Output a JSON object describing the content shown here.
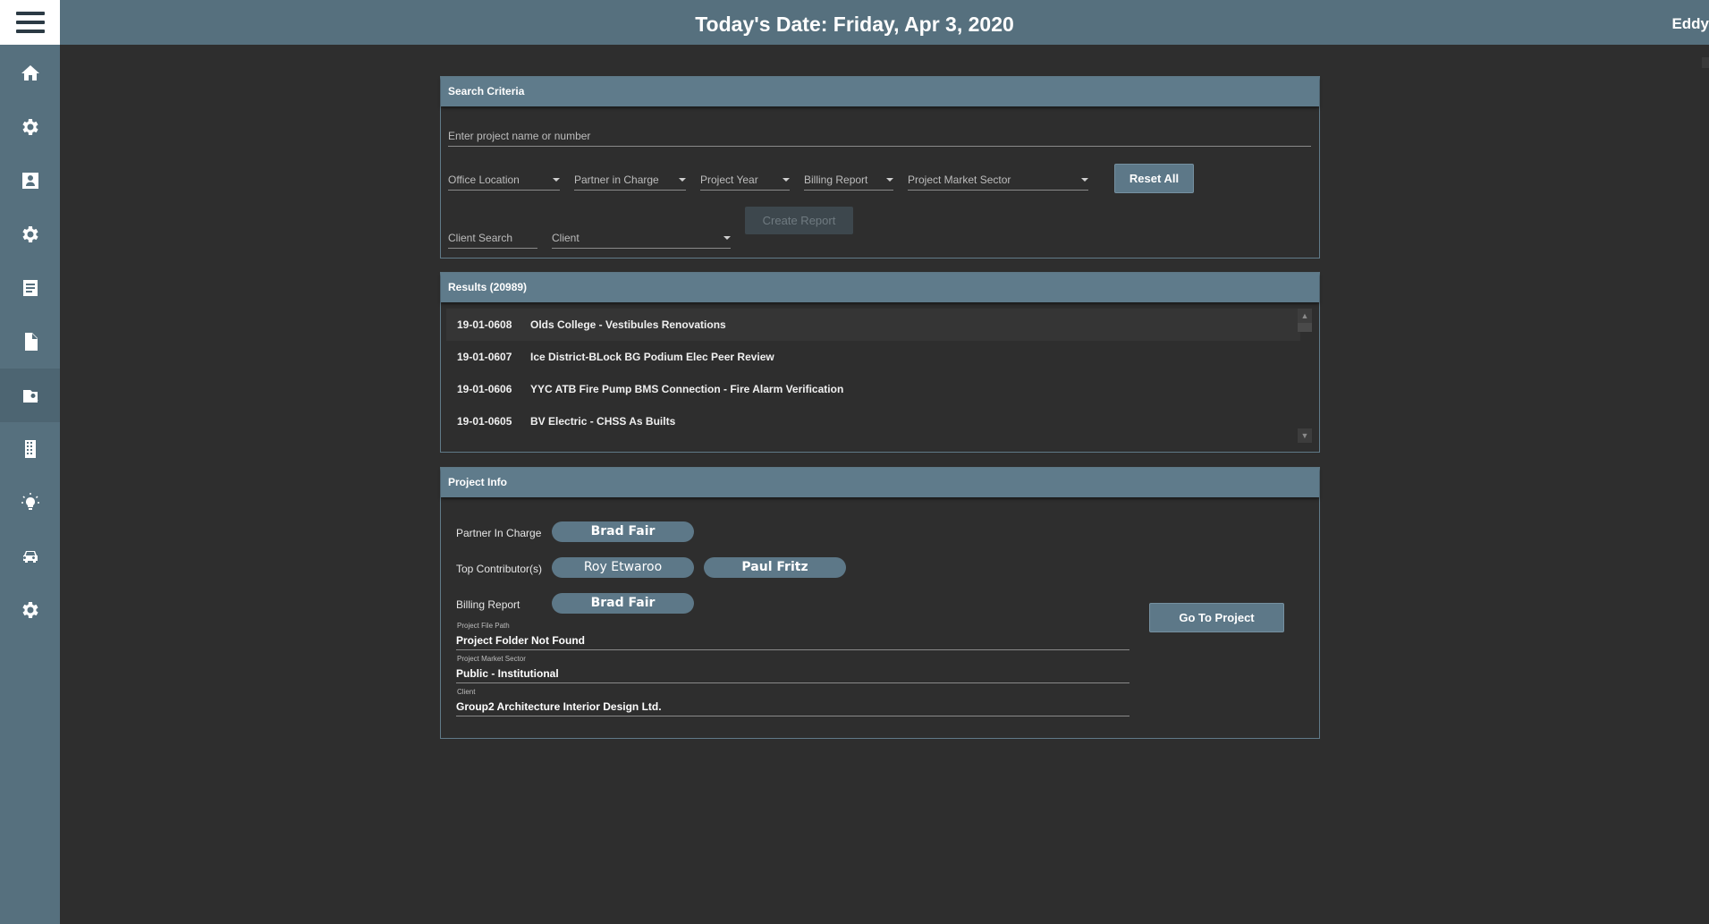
{
  "header": {
    "date_title": "Today's Date: Friday, Apr 3, 2020",
    "user": "Eddy"
  },
  "sidebar": {
    "items": [
      {
        "icon": "home-icon"
      },
      {
        "icon": "gear-icon"
      },
      {
        "icon": "contact-card-icon"
      },
      {
        "icon": "gear-icon"
      },
      {
        "icon": "document-list-icon"
      },
      {
        "icon": "file-icon"
      },
      {
        "icon": "folder-search-icon"
      },
      {
        "icon": "building-icon"
      },
      {
        "icon": "lightbulb-icon"
      },
      {
        "icon": "car-icon"
      },
      {
        "icon": "gear-icon"
      }
    ]
  },
  "search": {
    "title": "Search Criteria",
    "project_placeholder": "Enter project name or number",
    "filters": {
      "office_location": "Office Location",
      "partner_in_charge": "Partner in Charge",
      "project_year": "Project Year",
      "billing_report": "Billing Report",
      "project_market_sector": "Project Market Sector",
      "client_search": "Client Search",
      "client": "Client"
    },
    "reset_label": "Reset All",
    "create_label": "Create Report"
  },
  "results": {
    "title": "Results (20989)",
    "rows": [
      {
        "number": "19-01-0608",
        "name": "Olds College - Vestibules Renovations"
      },
      {
        "number": "19-01-0607",
        "name": "Ice District-BLock BG Podium Elec Peer Review"
      },
      {
        "number": "19-01-0606",
        "name": "YYC ATB Fire Pump BMS Connection - Fire Alarm Verification"
      },
      {
        "number": "19-01-0605",
        "name": "BV Electric - CHSS As Builts"
      }
    ]
  },
  "info": {
    "title": "Project Info",
    "partner_label": "Partner In Charge",
    "partner": "Brad Fair",
    "contributors_label": "Top Contributor(s)",
    "contributors": [
      "Roy Etwaroo",
      "Paul Fritz"
    ],
    "billing_label": "Billing Report",
    "billing": "Brad Fair",
    "file_path_caption": "Project File Path",
    "file_path": "Project Folder Not Found",
    "sector_caption": "Project Market Sector",
    "sector": "Public - Institutional",
    "client_caption": "Client",
    "client": "Group2 Architecture Interior Design Ltd.",
    "go_label": "Go To Project"
  }
}
